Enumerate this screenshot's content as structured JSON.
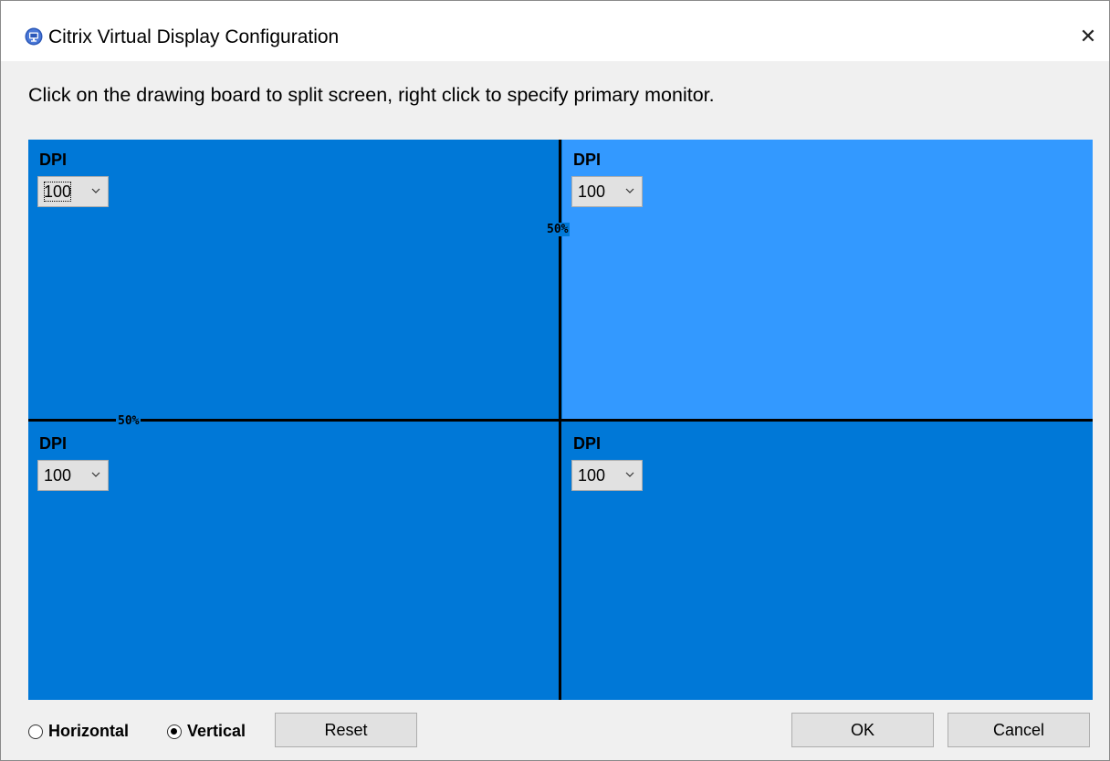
{
  "window": {
    "title": "Citrix Virtual Display Configuration",
    "close_glyph": "✕",
    "app_icon": "citrix-monitor-icon",
    "accent": "#0078d7",
    "highlight": "#3399ff"
  },
  "instruction": "Click on the drawing board to split screen, right click to specify primary monitor.",
  "board": {
    "vertical_split_label": "50%",
    "horizontal_split_label": "50%",
    "regions": [
      {
        "dpi_label": "DPI",
        "dpi_value": "100",
        "focused": true
      },
      {
        "dpi_label": "DPI",
        "dpi_value": "100"
      },
      {
        "dpi_label": "DPI",
        "dpi_value": "100"
      },
      {
        "dpi_label": "DPI",
        "dpi_value": "100"
      }
    ]
  },
  "footer": {
    "horizontal_label": "Horizontal",
    "vertical_label": "Vertical",
    "selected_orientation": "Vertical",
    "reset_label": "Reset",
    "ok_label": "OK",
    "cancel_label": "Cancel"
  }
}
